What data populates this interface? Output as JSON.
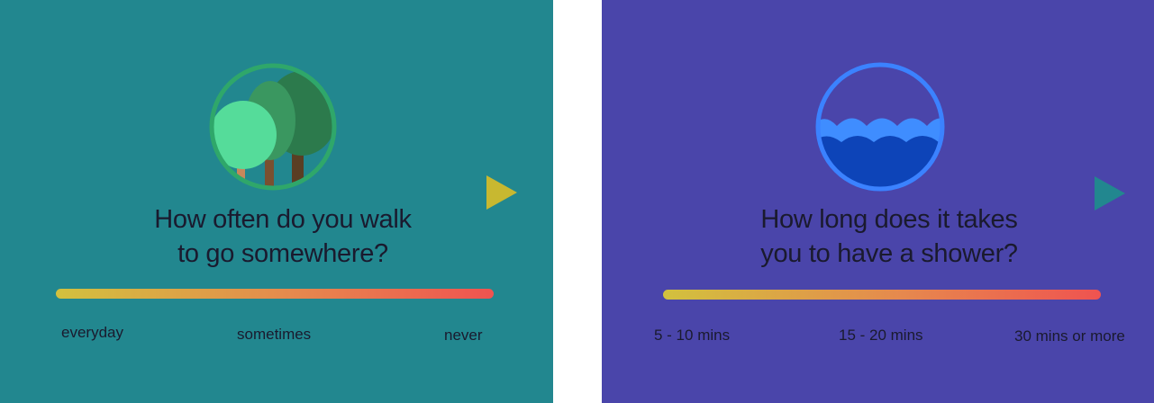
{
  "colors": {
    "card1_bg": "#22878f",
    "card2_bg": "#4a45aa",
    "text": "#1a1a2e",
    "slider_start": "#d2c13e",
    "slider_end": "#ef5350",
    "next_arrow_1": "#c8b830",
    "next_arrow_2": "#22878f"
  },
  "cards": [
    {
      "icon": "trees-icon",
      "question_line1": "How often do you walk",
      "question_line2": "to go somewhere?",
      "options": [
        "everyday",
        "sometimes",
        "never"
      ],
      "next_icon": "play-arrow-icon"
    },
    {
      "icon": "water-waves-icon",
      "question_line1": "How long does it takes",
      "question_line2": "you to have a shower?",
      "options": [
        "5 - 10 mins",
        "15 - 20 mins",
        "30 mins or more"
      ],
      "next_icon": "play-arrow-icon"
    }
  ]
}
